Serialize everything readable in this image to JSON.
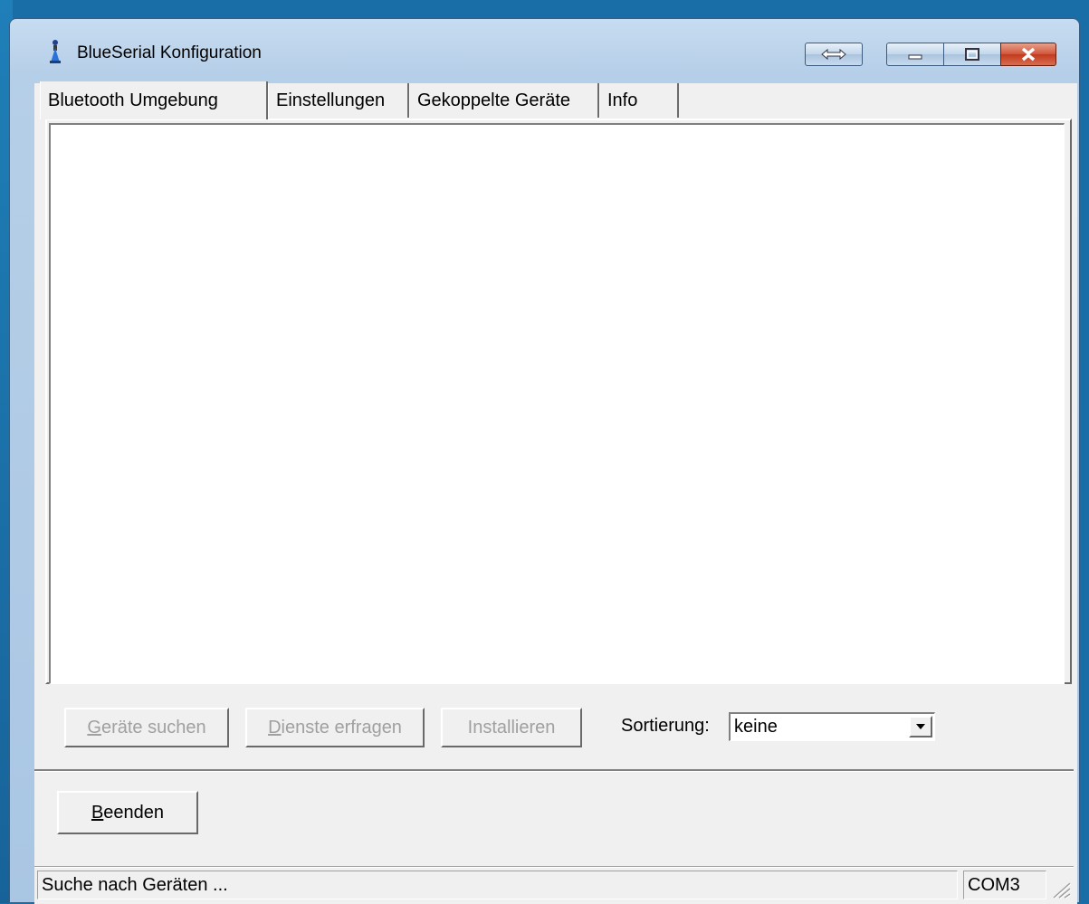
{
  "window": {
    "title": "BlueSerial Konfiguration"
  },
  "tabs": [
    {
      "label": "Bluetooth Umgebung",
      "active": true
    },
    {
      "label": "Einstellungen",
      "active": false
    },
    {
      "label": "Gekoppelte Geräte",
      "active": false
    },
    {
      "label": "Info",
      "active": false
    }
  ],
  "actions": {
    "search_devices": {
      "mnemonic": "G",
      "rest": "eräte suchen",
      "enabled": false
    },
    "query_services": {
      "mnemonic": "D",
      "rest": "ienste erfragen",
      "enabled": false
    },
    "install": {
      "label": "Installieren",
      "enabled": false
    }
  },
  "sort": {
    "label": "Sortierung:",
    "value": "keine"
  },
  "exit": {
    "mnemonic": "B",
    "rest": "eenden"
  },
  "status": {
    "message": "Suche nach Geräten ...",
    "port": "COM3"
  },
  "colors": {
    "desktop": "#1a6ea8",
    "frame": "#b6cfe8",
    "client": "#f0f0f0",
    "close": "#c23b1f"
  }
}
